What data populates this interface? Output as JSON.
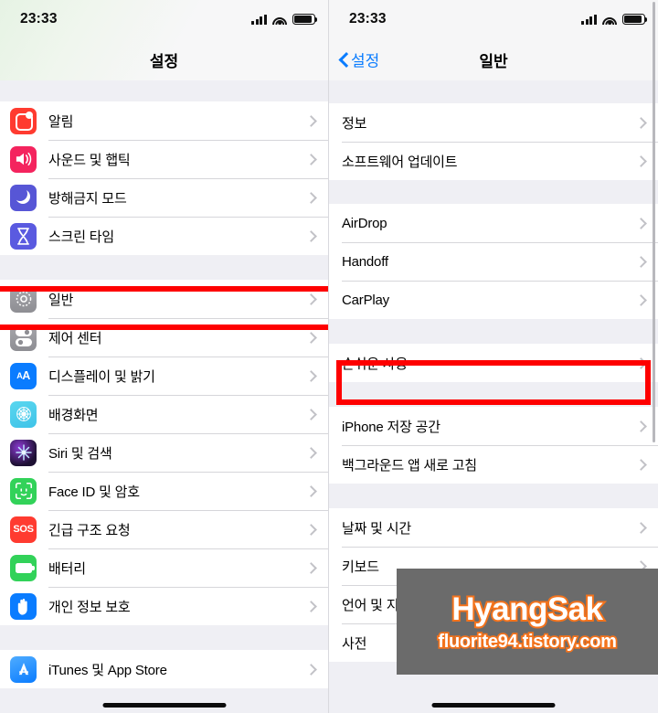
{
  "left_phone": {
    "status": {
      "time": "23:33",
      "signal_icon": "cellular-bars-icon",
      "wifi_icon": "wifi-icon",
      "battery_icon": "battery-icon"
    },
    "nav": {
      "title": "설정"
    },
    "sections": [
      {
        "rows": [
          {
            "label": "알림",
            "icon": "notifications-icon"
          },
          {
            "label": "사운드 및 햅틱",
            "icon": "sounds-haptics-icon"
          },
          {
            "label": "방해금지 모드",
            "icon": "do-not-disturb-icon"
          },
          {
            "label": "스크린 타임",
            "icon": "screen-time-icon"
          }
        ]
      },
      {
        "rows": [
          {
            "label": "일반",
            "icon": "general-gear-icon",
            "highlighted": true
          },
          {
            "label": "제어 센터",
            "icon": "control-center-icon"
          },
          {
            "label": "디스플레이 및 밝기",
            "icon": "display-brightness-icon"
          },
          {
            "label": "배경화면",
            "icon": "wallpaper-icon"
          },
          {
            "label": "Siri 및 검색",
            "icon": "siri-search-icon"
          },
          {
            "label": "Face ID 및 암호",
            "icon": "face-id-icon"
          },
          {
            "label": "긴급 구조 요청",
            "icon": "sos-icon"
          },
          {
            "label": "배터리",
            "icon": "battery-settings-icon"
          },
          {
            "label": "개인 정보 보호",
            "icon": "privacy-hand-icon"
          }
        ]
      },
      {
        "rows": [
          {
            "label": "iTunes 및 App Store",
            "icon": "app-store-icon"
          }
        ]
      }
    ]
  },
  "right_phone": {
    "status": {
      "time": "23:33",
      "signal_icon": "cellular-bars-icon",
      "wifi_icon": "wifi-icon",
      "battery_icon": "battery-icon"
    },
    "nav": {
      "back_label": "설정",
      "back_icon": "chevron-left-icon",
      "title": "일반"
    },
    "sections": [
      {
        "rows": [
          {
            "label": "정보"
          },
          {
            "label": "소프트웨어 업데이트"
          }
        ]
      },
      {
        "rows": [
          {
            "label": "AirDrop"
          },
          {
            "label": "Handoff"
          },
          {
            "label": "CarPlay"
          }
        ]
      },
      {
        "rows": [
          {
            "label": "손쉬운 사용",
            "highlighted": true
          }
        ]
      },
      {
        "rows": [
          {
            "label": "iPhone 저장 공간"
          },
          {
            "label": "백그라운드 앱 새로 고침"
          }
        ]
      },
      {
        "rows": [
          {
            "label": "날짜 및 시간"
          },
          {
            "label": "키보드"
          },
          {
            "label": "언어 및 지역"
          },
          {
            "label": "사전"
          }
        ]
      }
    ]
  },
  "watermark": {
    "line1": "HyangSak",
    "line2": "fluorite94.tistory.com"
  },
  "colors": {
    "highlight": "#fe0000",
    "accent_blue": "#0a7cff",
    "watermark_orange": "#f4731c",
    "watermark_bg": "#6b6b6b"
  }
}
